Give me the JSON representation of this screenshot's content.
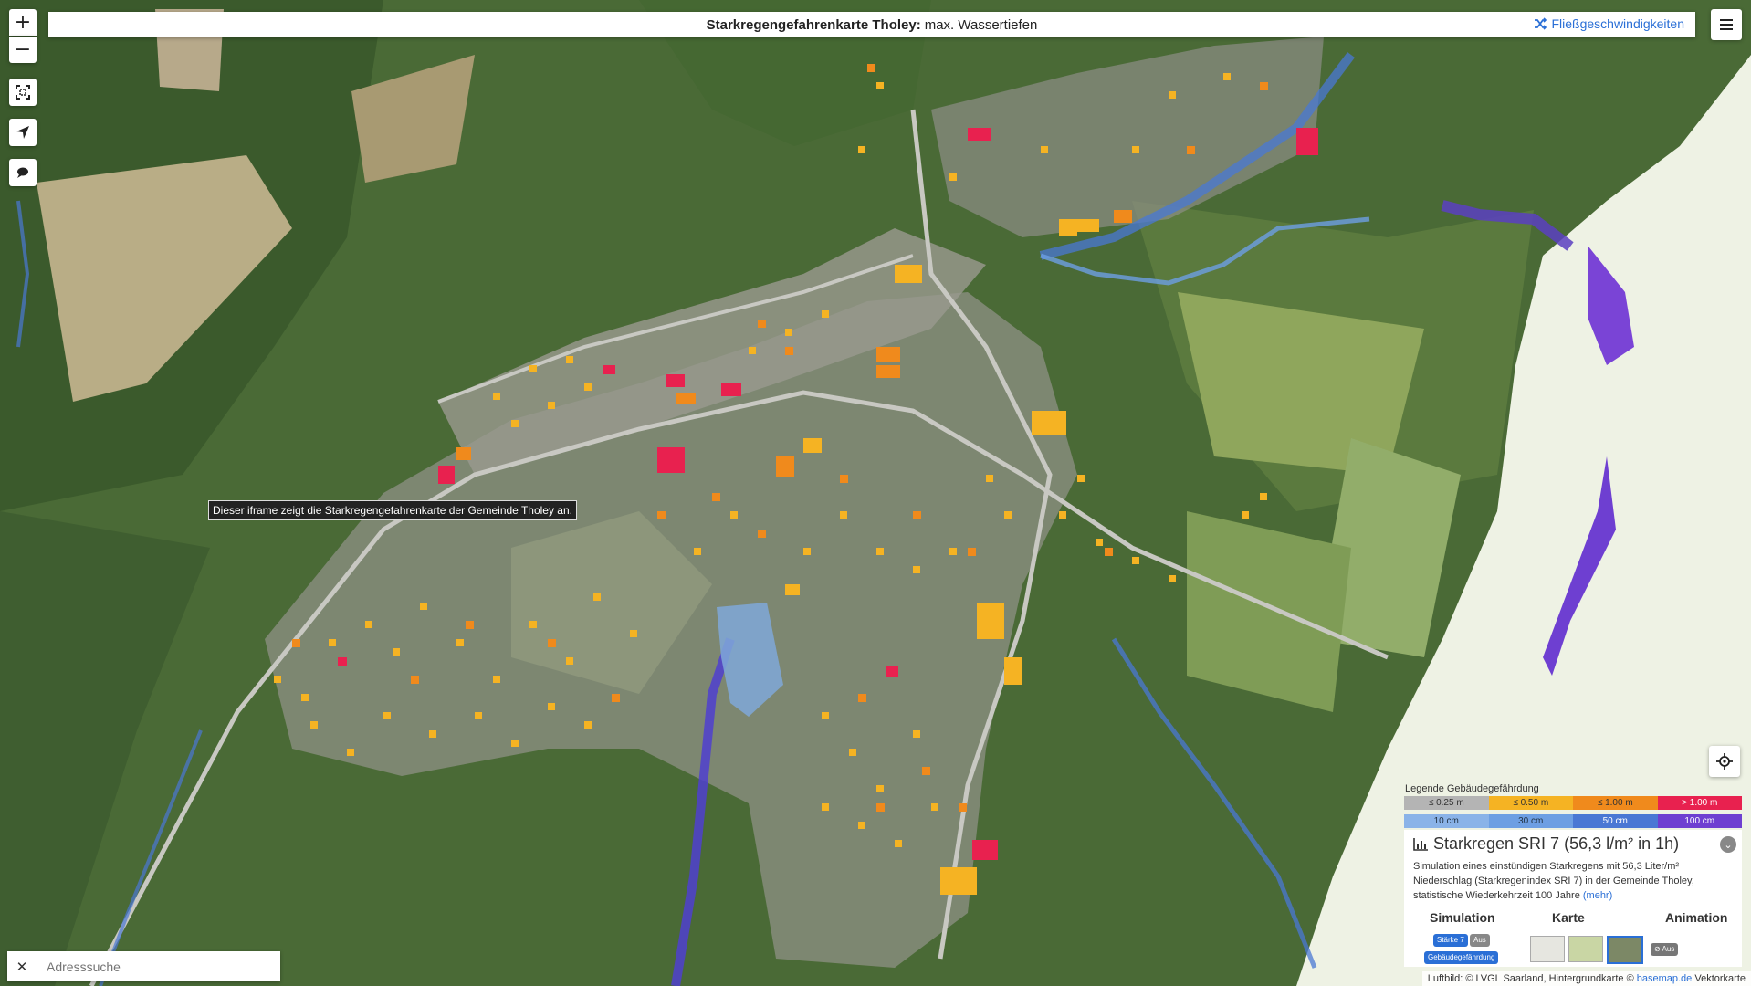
{
  "title": {
    "bold": "Starkregengefahrenkarte Tholey:",
    "rest": "max. Wassertiefen",
    "flow_link": "Fließgeschwindigkeiten"
  },
  "map_controls": {
    "zoom_in": "+",
    "zoom_out": "−"
  },
  "tooltip": "Dieser iframe zeigt die Starkregengefahrenkarte der Gemeinde Tholey an.",
  "legend": {
    "title": "Legende Gebäudegefährdung",
    "hazard": [
      {
        "label": "≤ 0.25 m",
        "color": "#b4b4b4"
      },
      {
        "label": "≤ 0.50 m",
        "color": "#f5b323"
      },
      {
        "label": "≤ 1.00 m",
        "color": "#f08a1c"
      },
      {
        "label": "> 1.00 m",
        "color": "#e8214f"
      }
    ],
    "depth": [
      {
        "label": "10 cm",
        "color": "#8ab3e8"
      },
      {
        "label": "30 cm",
        "color": "#6d9fe3"
      },
      {
        "label": "50 cm",
        "color": "#4a78d4"
      },
      {
        "label": "100 cm",
        "color": "#6e3fd1"
      }
    ]
  },
  "panel": {
    "title": "Starkregen SRI 7 (56,3 l/m² in 1h)",
    "description": "Simulation eines einstündigen Starkregens mit 56,3 Liter/m² Niederschlag (Starkregenindex SRI 7) in der Gemeinde Tholey, statistische Wiederkehrzeit 100 Jahre",
    "more_link": "(mehr)",
    "col_simulation": "Simulation",
    "col_karte": "Karte",
    "col_animation": "Animation",
    "btn_staerke": "Stärke 7",
    "btn_aus": "Aus",
    "btn_gebaeude": "Gebäudegefährdung",
    "btn_animation_aus": "⊘ Aus"
  },
  "search": {
    "placeholder": "Adresssuche",
    "clear": "✕"
  },
  "attribution": {
    "text": "Luftbild: © LVGL Saarland, Hintergrundkarte ©",
    "link": "basemap.de",
    "suffix": "Vektorkarte"
  },
  "colors": {
    "accent": "#2a6fd6",
    "forest": "#3e5a2e",
    "field": "#8ea866",
    "settlement": "#9a9a92"
  }
}
